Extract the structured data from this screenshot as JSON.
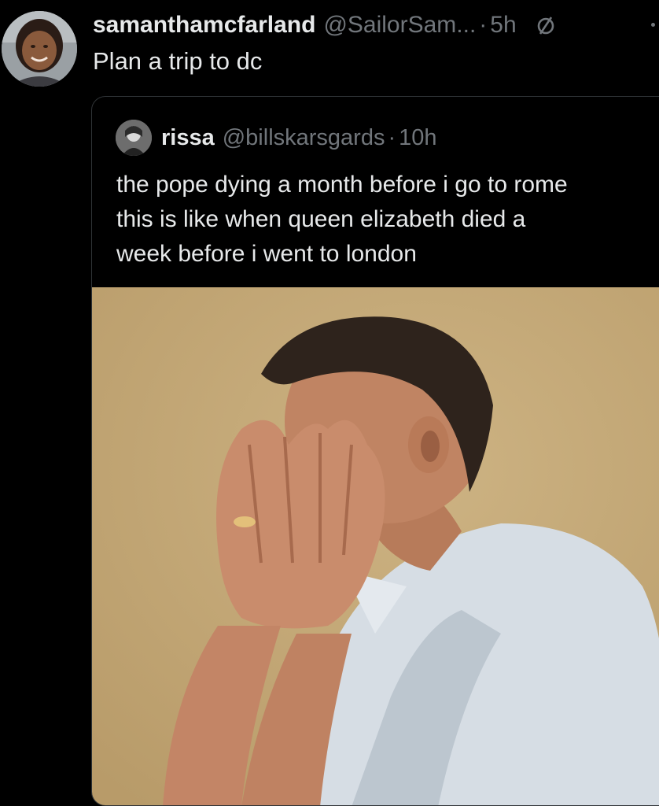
{
  "tweet": {
    "display_name": "samanthamcfarland",
    "handle": "@SailorSam...",
    "separator": "·",
    "time": "5h",
    "text": "Plan a trip to dc",
    "icons": {
      "avatar": "profile-photo",
      "menu": "slashed-circle-icon"
    }
  },
  "quoted_tweet": {
    "display_name": "rissa",
    "handle": "@billskarsgards",
    "separator": "·",
    "time": "10h",
    "text_lines": [
      "the pope dying a month before i go to rome",
      "this is like when queen elizabeth died a",
      "week before i went to london"
    ],
    "media": {
      "kind": "photo",
      "subject": "man covering his face with both hands",
      "background_color": "#c3a877"
    }
  },
  "colors": {
    "background": "#000000",
    "primary_text": "#e7e9ea",
    "secondary_text": "#71767b",
    "border": "#2f3336"
  }
}
